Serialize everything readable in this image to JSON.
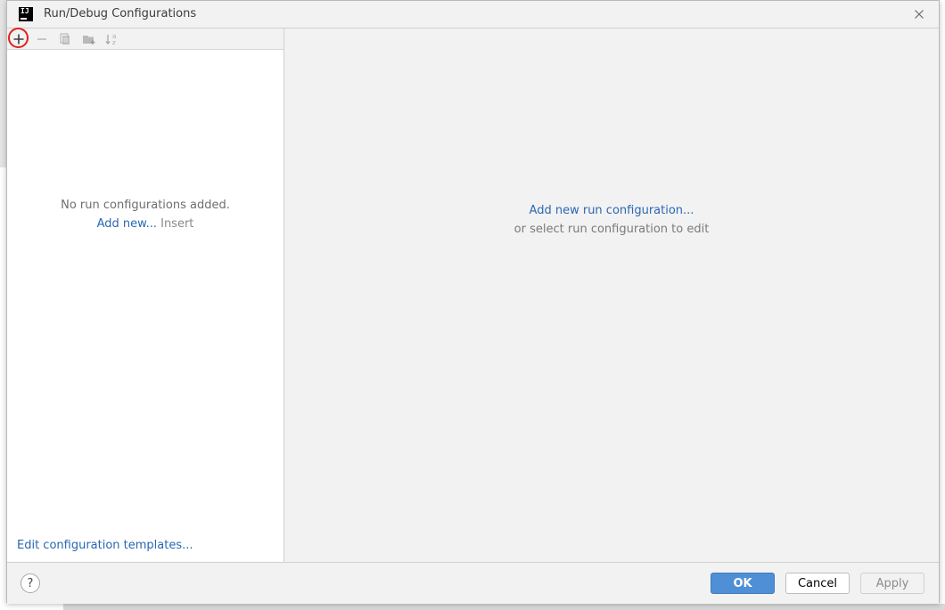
{
  "window": {
    "title": "Run/Debug Configurations",
    "app_icon_text": "IJ"
  },
  "toolbar": {
    "icons": [
      "add-icon",
      "remove-icon",
      "copy-icon",
      "new-folder-icon",
      "sort-alphabetically-icon"
    ],
    "highlight_color": "#e02020"
  },
  "left_panel": {
    "empty_message": "No run configurations added.",
    "add_new_link": "Add new...",
    "add_new_shortcut": "Insert",
    "templates_link": "Edit configuration templates..."
  },
  "right_panel": {
    "add_link": "Add new run configuration...",
    "hint": "or select run configuration to edit"
  },
  "footer": {
    "help_label": "?",
    "ok_label": "OK",
    "cancel_label": "Cancel",
    "apply_label": "Apply"
  },
  "colors": {
    "link": "#2a67b3",
    "primary_button": "#4e8fd6"
  }
}
